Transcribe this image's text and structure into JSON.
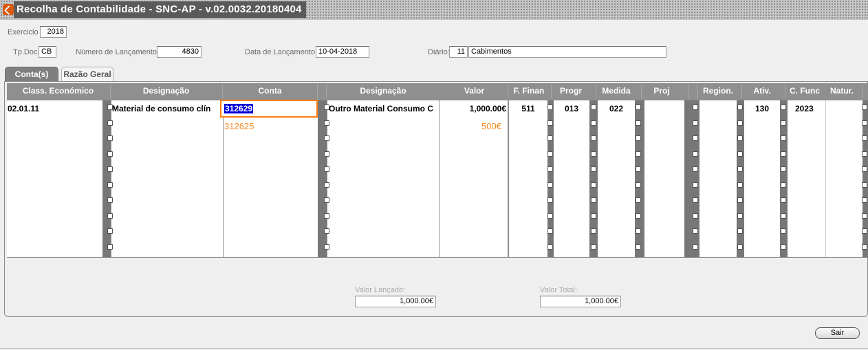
{
  "window": {
    "title": "Recolha de Contabilidade - SNC-AP - v.02.0032.20180404"
  },
  "header": {
    "exercicio_label": "Exercicio",
    "exercicio_value": "2018",
    "tpdoc_label": "Tp.Doc.",
    "tpdoc_value": "CB",
    "numero_label": "Número de Lançamento:",
    "numero_value": "4830",
    "data_label": "Data de Lançamento:",
    "data_value": "10-04-2018",
    "diario_label": "Diário:",
    "diario_code": "11",
    "diario_name": "Cabimentos"
  },
  "tabs": [
    {
      "label": "Conta(s)",
      "active": true
    },
    {
      "label": "Razão Geral",
      "active": false
    }
  ],
  "table": {
    "headers": [
      "Class. Económico",
      "Designação",
      "Conta",
      "Designação",
      "Valor",
      "F. Finan",
      "Progr",
      "Medida",
      "Proj",
      "Region.",
      "Ativ.",
      "C. Func",
      "Natur."
    ],
    "row": {
      "class_economico": "02.01.11",
      "designacao1": "Material de consumo clín",
      "conta": "312629",
      "designacao2": "Outro Material Consumo C",
      "valor": "1,000.00€",
      "f_finan": "511",
      "progr": "013",
      "medida": "022",
      "ativ": "130",
      "c_func": "2023"
    },
    "annotation": {
      "conta": "312625",
      "valor": "500€",
      "color": "#f5891f"
    }
  },
  "totals": {
    "valor_lancado_label": "Valor Lançado:",
    "valor_lancado": "1,000.00€",
    "valor_total_label": "Valor Total:",
    "valor_total": "1,000.00€"
  },
  "buttons": {
    "sair": "Sair"
  },
  "colors": {
    "title_bg": "#5a5a5a",
    "active_tab": "#7f7f7f",
    "selection": "#0000d8",
    "focus_border": "#ff7f0f"
  }
}
